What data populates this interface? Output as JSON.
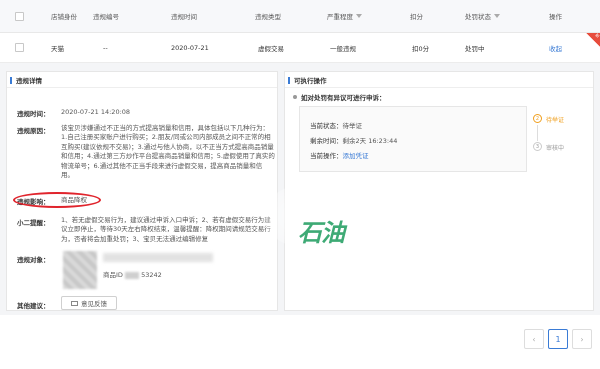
{
  "table": {
    "headers": {
      "shop_type": "店铺身份",
      "product_no": "违规编号",
      "violation_time": "违规时间",
      "violation_type": "违规类型",
      "severity": "严重程度",
      "points": "扣分",
      "status": "处罚状态",
      "action": "操作"
    },
    "row": {
      "shop_type": "天猫",
      "product_no": "--",
      "violation_time": "2020-07-21",
      "violation_type": "虚假交易",
      "severity": "一般违规",
      "points": "扣0分",
      "status": "处罚中",
      "action": "收起",
      "corner_badge": "新"
    }
  },
  "violation_detail": {
    "title": "违规详情",
    "time_label": "违规时间：",
    "time_value": "2020-07-21 14:20:08",
    "reason_label": "违规原因：",
    "reason_value": "该宝贝涉嫌通过不正当的方式提高销量和信用，具体包括以下几种行为：1.自己注册买家账户进行购买；2.朋友/同或公司内部成员之间不正常的相互购买(建议依规不交易)；3.通过与他人协商，以不正当方式提高商品销量和信用；4.通过第三方炒作平台提高商品销量和信用；5.虚假使用了真实的物流单号；6.通过其他不正当手段来进行虚假交易，提高商品销量和信用。",
    "impact_label": "违规影响：",
    "impact_value": "商品降权",
    "tip_label": "小二提醒：",
    "tip_value": "1、若无虚假交易行为，建议通过申诉入口申诉；2、若有虚假交易行为建议立即停止，等待30天左右降权结束，温馨提醒：降权期间请规范交易行为，否者将会加重处罚；3、宝贝无法通过编辑修复",
    "object_label": "违规对象：",
    "product_id_label": "商品ID",
    "product_id_value": "53242",
    "other_label": "其他建议：",
    "feedback_button": "意见反馈"
  },
  "actions_panel": {
    "title": "可执行操作",
    "appeal_title": "如对处罚有异议可进行申诉：",
    "status_label": "当前状态：",
    "status_value": "待举证",
    "remaining_label": "剩余时间：",
    "remaining_value": "剩余2天 16:23:44",
    "operation_label": "当前操作：",
    "operation_link": "添加凭证",
    "steps": [
      {
        "num": "2",
        "label": "待举证",
        "active": true
      },
      {
        "num": "3",
        "label": "审核中",
        "active": false
      }
    ]
  },
  "watermark": "石油",
  "pagination": {
    "prev": "‹",
    "current": "1",
    "next": "›"
  },
  "colors": {
    "link": "#3a7bd5",
    "step_active": "#f0a020",
    "highlight_circle": "#e0242c",
    "watermark": "#2ea36a"
  }
}
